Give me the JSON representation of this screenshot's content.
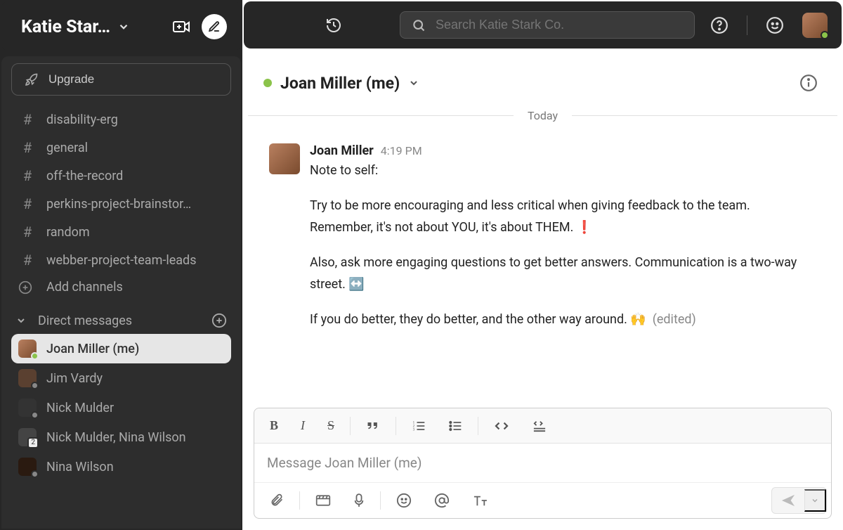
{
  "workspace": {
    "name": "Katie Star…"
  },
  "sidebar": {
    "upgrade_label": "Upgrade",
    "channels": [
      "disability-erg",
      "general",
      "off-the-record",
      "perkins-project-brainstor…",
      "random",
      "webber-project-team-leads"
    ],
    "add_channels_label": "Add channels",
    "dm_section_label": "Direct messages",
    "dms": [
      {
        "name": "Joan Miller (me)",
        "active": true,
        "online": true
      },
      {
        "name": "Jim Vardy"
      },
      {
        "name": "Nick Mulder"
      },
      {
        "name": "Nick Mulder, Nina Wilson",
        "count": 2
      },
      {
        "name": "Nina Wilson"
      }
    ]
  },
  "search": {
    "placeholder": "Search Katie Stark Co."
  },
  "conversation": {
    "title": "Joan Miller (me)",
    "date_label": "Today",
    "message": {
      "author": "Joan Miller",
      "time": "4:19 PM",
      "line1": "Note to self:",
      "line2": "Try to be more encouraging and less critical when giving feedback to the team. Remember, it's not about YOU, it's about THEM.  ❗",
      "line3": "Also, ask more engaging questions to get better answers. Communication is a two-way street. ↔️",
      "line4_text": "If you do better, they do better, and the other way around. 🙌",
      "edited_label": "(edited)"
    }
  },
  "composer": {
    "placeholder": "Message Joan Miller (me)"
  }
}
